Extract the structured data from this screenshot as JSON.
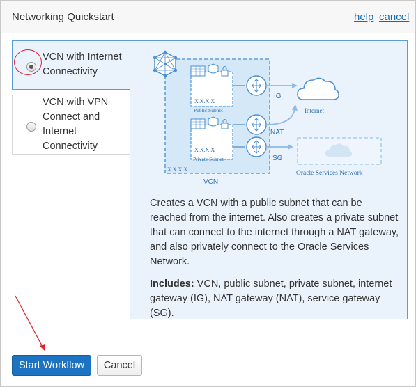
{
  "dialog": {
    "title": "Networking Quickstart",
    "help_link": "help",
    "cancel_link": "cancel"
  },
  "options": [
    {
      "label": "VCN with Internet Connectivity",
      "selected": true
    },
    {
      "label": "VCN with VPN Connect and Internet Connectivity",
      "selected": false
    }
  ],
  "diagram": {
    "public_subnet": "Public Subnet",
    "private_subnet": "Private Subnet",
    "ip_placeholder": "X.X.X.X",
    "vcn": "VCN",
    "ig": "IG",
    "nat": "NAT",
    "sg": "SG",
    "internet": "Internet",
    "oracle_services": "Oracle Services Network"
  },
  "description": "Creates a VCN with a public subnet that can be reached from the internet. Also creates a private subnet that can connect to the internet through a NAT gateway, and also privately connect to the Oracle Services Network.",
  "includes": {
    "label": "Includes:",
    "text": " VCN, public subnet, private subnet, internet gateway (IG), NAT gateway (NAT), service gateway (SG)."
  },
  "footer": {
    "start_button": "Start Workflow",
    "cancel_button": "Cancel"
  },
  "colors": {
    "accent": "#1b73c1",
    "link": "#0d6db8",
    "panel_bg": "#eaf3fc",
    "annotation_red": "#e0232e"
  }
}
